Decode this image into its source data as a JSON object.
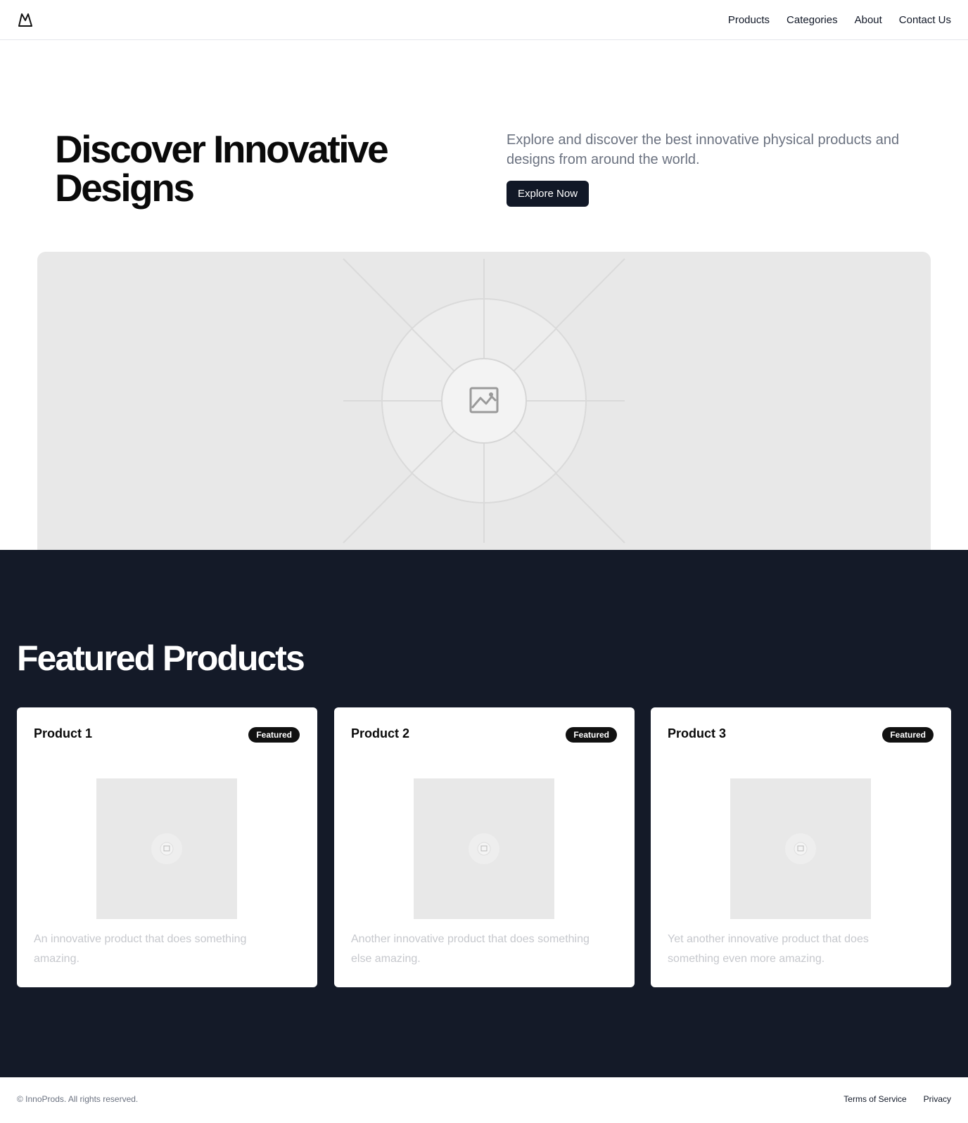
{
  "header": {
    "logo_icon": "mountain-logo-icon",
    "nav": [
      "Products",
      "Categories",
      "About",
      "Contact Us"
    ]
  },
  "hero": {
    "title": "Discover Innovative Designs",
    "description": "Explore and discover the best innovative physical products and designs from around the world.",
    "button_label": "Explore Now",
    "image_icon": "image-placeholder-icon"
  },
  "featured": {
    "title": "Featured Products",
    "products": [
      {
        "name": "Product 1",
        "badge": "Featured",
        "description": "An innovative product that does something amazing."
      },
      {
        "name": "Product 2",
        "badge": "Featured",
        "description": "Another innovative product that does something else amazing."
      },
      {
        "name": "Product 3",
        "badge": "Featured",
        "description": "Yet another innovative product that does something even more amazing."
      }
    ]
  },
  "footer": {
    "copyright": "© InnoProds. All rights reserved.",
    "links": [
      "Terms of Service",
      "Privacy"
    ]
  },
  "colors": {
    "dark": "#141a28",
    "button": "#111827",
    "muted_text": "#6b7280",
    "placeholder": "#e8e8e8"
  }
}
